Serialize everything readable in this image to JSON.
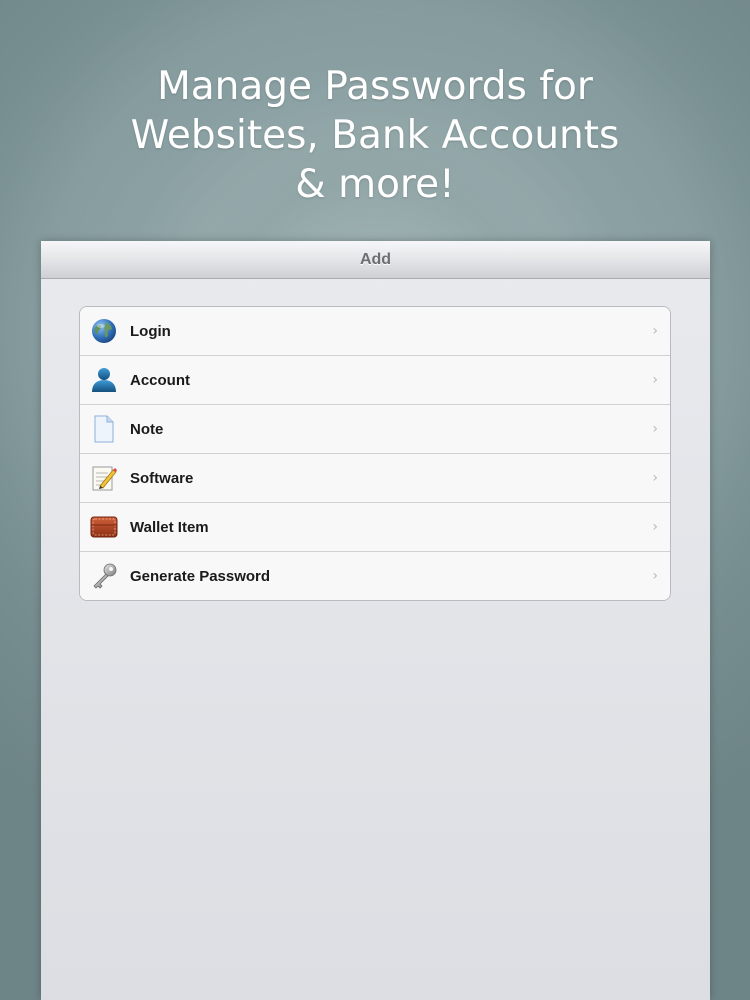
{
  "promo": {
    "headline_lines": [
      "Manage Passwords for",
      "Websites, Bank Accounts",
      "& more!"
    ]
  },
  "navbar": {
    "title": "Add"
  },
  "items": [
    {
      "label": "Login",
      "icon": "globe-icon"
    },
    {
      "label": "Account",
      "icon": "person-icon"
    },
    {
      "label": "Note",
      "icon": "note-icon"
    },
    {
      "label": "Software",
      "icon": "software-icon"
    },
    {
      "label": "Wallet Item",
      "icon": "wallet-icon"
    },
    {
      "label": "Generate Password",
      "icon": "key-icon"
    }
  ],
  "chevron_glyph": "›",
  "colors": {
    "background": "#8aa0a2",
    "panel": "#e2e4e8",
    "label_text": "#1a1a1a"
  }
}
